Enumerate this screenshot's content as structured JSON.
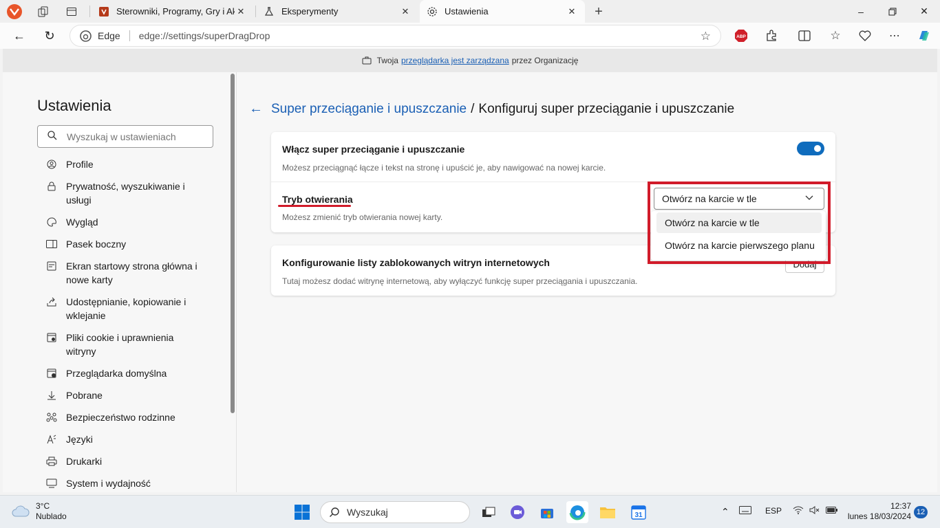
{
  "tabs": [
    {
      "title": "Sterowniki, Programy, Gry i Aktualności",
      "icon": "shield-favicon-icon"
    },
    {
      "title": "Eksperymenty",
      "icon": "flask-icon"
    },
    {
      "title": "Ustawienia",
      "icon": "gear-icon"
    }
  ],
  "tab_close": "✕",
  "new_tab": "+",
  "address": {
    "edge_label": "Edge",
    "url": "edge://settings/superDragDrop"
  },
  "managed": {
    "prefix": "Twoja",
    "link": "przeglądarka jest zarządzana",
    "suffix": "przez Organizację"
  },
  "sidebar": {
    "title": "Ustawienia",
    "search_placeholder": "Wyszukaj w ustawieniach",
    "items": [
      {
        "label": "Profile",
        "icon": "profile-icon"
      },
      {
        "label": "Prywatność, wyszukiwanie i usługi",
        "icon": "lock-icon"
      },
      {
        "label": "Wygląd",
        "icon": "palette-icon"
      },
      {
        "label": "Pasek boczny",
        "icon": "sidebar-icon"
      },
      {
        "label": "Ekran startowy strona główna i nowe karty",
        "icon": "home-icon"
      },
      {
        "label": "Udostępnianie, kopiowanie i wklejanie",
        "icon": "share-icon"
      },
      {
        "label": "Pliki cookie i uprawnienia witryny",
        "icon": "cookie-icon"
      },
      {
        "label": "Przeglądarka domyślna",
        "icon": "browser-icon"
      },
      {
        "label": "Pobrane",
        "icon": "download-icon"
      },
      {
        "label": "Bezpieczeństwo rodzinne",
        "icon": "family-icon"
      },
      {
        "label": "Języki",
        "icon": "language-icon"
      },
      {
        "label": "Drukarki",
        "icon": "printer-icon"
      },
      {
        "label": "System i wydajność",
        "icon": "system-icon"
      }
    ]
  },
  "breadcrumb": {
    "parent": "Super przeciąganie i upuszczanie",
    "separator": "/",
    "current": "Konfiguruj super przeciąganie i upuszczanie"
  },
  "enable_row": {
    "title": "Włącz super przeciąganie i upuszczanie",
    "desc": "Możesz przeciągnąć łącze i tekst na stronę i upuścić je, aby nawigować na nowej karcie.",
    "enabled": true
  },
  "mode_row": {
    "title": "Tryb otwierania",
    "desc": "Możesz zmienić tryb otwierania nowej karty.",
    "selected": "Otwórz na karcie w tle",
    "options": [
      "Otwórz na karcie w tle",
      "Otwórz na karcie pierwszego planu"
    ]
  },
  "block_row": {
    "title": "Konfigurowanie listy zablokowanych witryn internetowych",
    "desc": "Tutaj możesz dodać witrynę internetową, aby wyłączyć funkcję super przeciągania i upuszczania.",
    "button": "Dodaj"
  },
  "taskbar": {
    "weather_temp": "3°C",
    "weather_desc": "Nublado",
    "search": "Wyszukaj",
    "lang": "ESP",
    "time": "12:37",
    "date": "lunes 18/03/2024",
    "notifications": "12"
  },
  "colors": {
    "accent": "#0f6cbd",
    "highlight": "#d11b2a",
    "link": "#1a5fb4"
  }
}
